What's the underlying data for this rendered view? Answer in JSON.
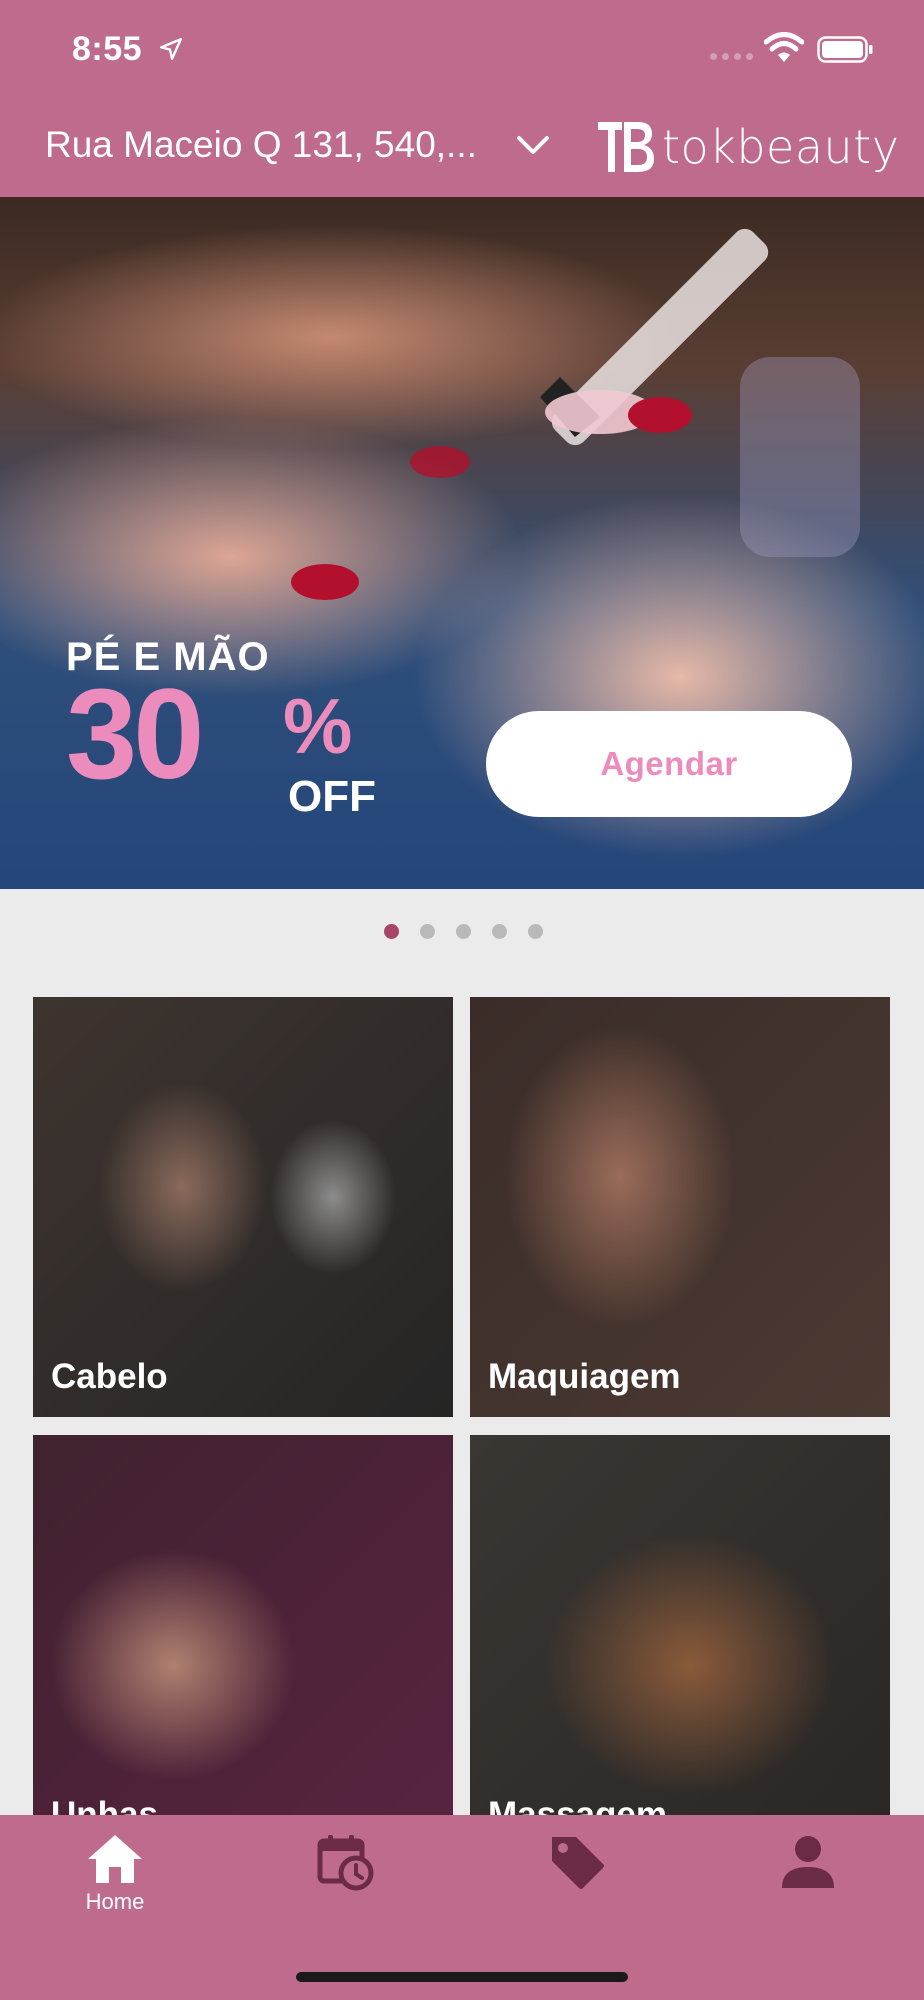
{
  "status_bar": {
    "time": "8:55"
  },
  "app_bar": {
    "address": "Rua Maceio Q 131, 540,...",
    "brand_name": "tokbeauty"
  },
  "banner": {
    "line1": "PÉ E MÃO",
    "discount": "30",
    "percent": "%",
    "off": "OFF",
    "cta_label": "Agendar",
    "pager": {
      "count": 5,
      "active_index": 0
    }
  },
  "categories": [
    {
      "label": "Cabelo"
    },
    {
      "label": "Maquiagem"
    },
    {
      "label": "Unhas"
    },
    {
      "label": "Massagem"
    }
  ],
  "bottom_nav": [
    {
      "icon": "home-icon",
      "label": "Home",
      "active": true
    },
    {
      "icon": "calendar-clock-icon"
    },
    {
      "icon": "tag-icon"
    },
    {
      "icon": "person-icon"
    }
  ],
  "colors": {
    "brand": "#bf6b8d",
    "accent_pink": "#ec8cbd",
    "active_dot": "#a9456b",
    "nav_icon_inactive": "#6b2a45"
  }
}
